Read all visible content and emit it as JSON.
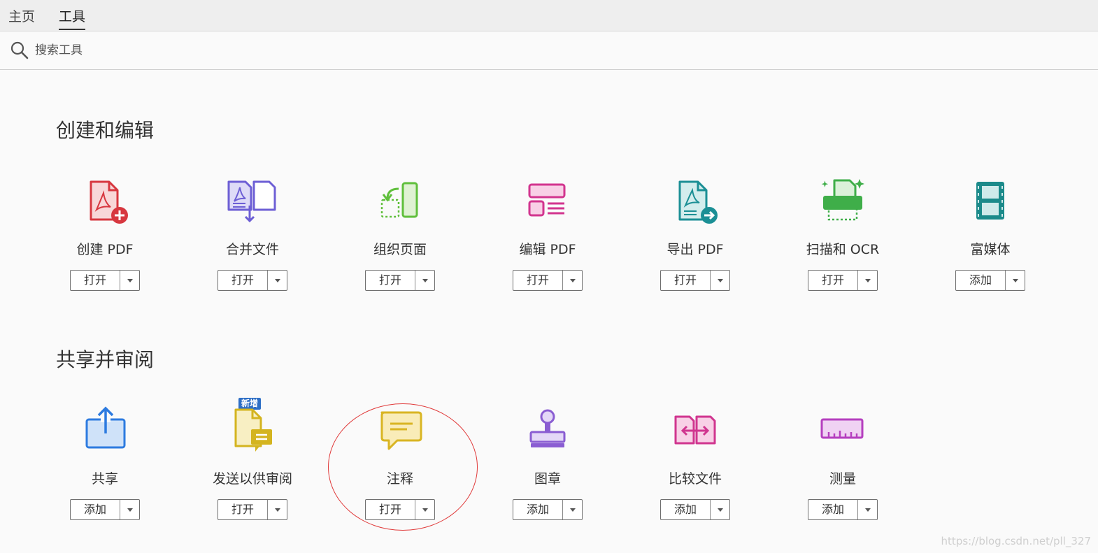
{
  "tabs": {
    "home": "主页",
    "tools": "工具"
  },
  "search": {
    "placeholder": "搜索工具"
  },
  "sections": [
    {
      "title": "创建和编辑"
    },
    {
      "title": "共享并审阅"
    }
  ],
  "tools_create": [
    {
      "label": "创建 PDF",
      "action": "打开",
      "icon": "create-pdf-icon",
      "color": "#d7373f"
    },
    {
      "label": "合并文件",
      "action": "打开",
      "icon": "combine-files-icon",
      "color": "#6d5fd5"
    },
    {
      "label": "组织页面",
      "action": "打开",
      "icon": "organize-pages-icon",
      "color": "#5fbf3b"
    },
    {
      "label": "编辑 PDF",
      "action": "打开",
      "icon": "edit-pdf-icon",
      "color": "#d2358f"
    },
    {
      "label": "导出 PDF",
      "action": "打开",
      "icon": "export-pdf-icon",
      "color": "#1b8f95"
    },
    {
      "label": "扫描和 OCR",
      "action": "打开",
      "icon": "scan-ocr-icon",
      "color": "#3fae49"
    },
    {
      "label": "富媒体",
      "action": "添加",
      "icon": "rich-media-icon",
      "color": "#1b8a8a"
    }
  ],
  "tools_share": [
    {
      "label": "共享",
      "action": "添加",
      "icon": "share-icon",
      "color": "#2d7be0"
    },
    {
      "label": "发送以供审阅",
      "action": "打开",
      "icon": "send-for-review-icon",
      "color": "#d4b41f",
      "badge": "新增"
    },
    {
      "label": "注释",
      "action": "打开",
      "icon": "comment-icon",
      "color": "#d9b523"
    },
    {
      "label": "图章",
      "action": "添加",
      "icon": "stamp-icon",
      "color": "#8a5dd2"
    },
    {
      "label": "比较文件",
      "action": "添加",
      "icon": "compare-files-icon",
      "color": "#d0358f"
    },
    {
      "label": "测量",
      "action": "添加",
      "icon": "measure-icon",
      "color": "#b53fbf"
    }
  ],
  "watermark": "https://blog.csdn.net/pll_327"
}
